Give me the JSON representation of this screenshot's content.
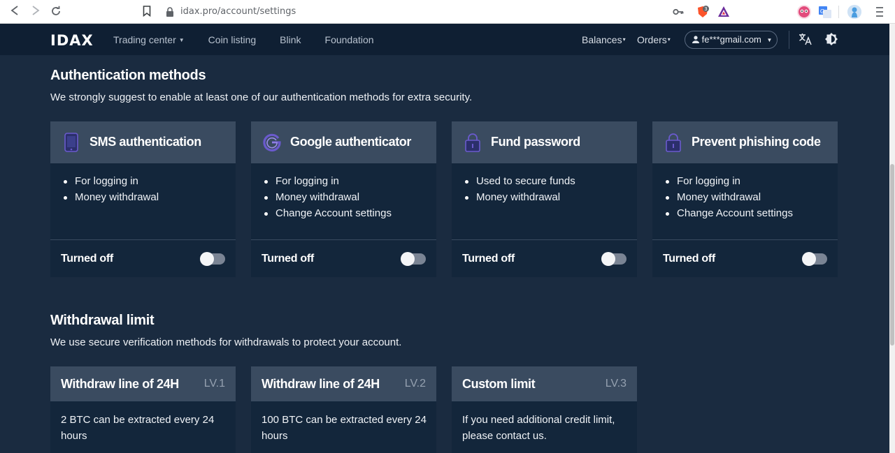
{
  "browser": {
    "url": "idax.pro/account/settings",
    "brave_badge": "3"
  },
  "header": {
    "logo": "IDAX",
    "nav": [
      "Trading center",
      "Coin listing",
      "Blink",
      "Foundation"
    ],
    "balances": "Balances",
    "orders": "Orders",
    "user": "fe***gmail.com"
  },
  "auth": {
    "title": "Authentication methods",
    "description": "We strongly suggest to enable at least one of our authentication methods for extra security.",
    "cards": [
      {
        "title": "SMS authentication",
        "icon": "phone-icon",
        "items": [
          "For logging in",
          "Money withdrawal"
        ],
        "status": "Turned off",
        "enabled": false
      },
      {
        "title": "Google authenticator",
        "icon": "google-icon",
        "items": [
          "For logging in",
          "Money withdrawal",
          "Change Account settings"
        ],
        "status": "Turned off",
        "enabled": false
      },
      {
        "title": "Fund password",
        "icon": "lock-icon",
        "items": [
          "Used to secure funds",
          "Money withdrawal"
        ],
        "status": "Turned off",
        "enabled": false
      },
      {
        "title": "Prevent phishing code",
        "icon": "lock-icon",
        "items": [
          "For logging in",
          "Money withdrawal",
          "Change Account settings"
        ],
        "status": "Turned off",
        "enabled": false
      }
    ]
  },
  "withdrawal": {
    "title": "Withdrawal limit",
    "description": "We use secure verification methods for withdrawals to protect your account.",
    "cards": [
      {
        "title": "Withdraw line of 24H",
        "level": "LV.1",
        "text": "2 BTC can be extracted every 24 hours"
      },
      {
        "title": "Withdraw line of 24H",
        "level": "LV.2",
        "text": "100 BTC can be extracted every 24 hours"
      },
      {
        "title": "Custom limit",
        "level": "LV.3",
        "text": "If you need additional credit limit, please contact us."
      }
    ]
  },
  "colors": {
    "page_bg": "#1a2b40",
    "header_bg": "#0f1f33",
    "card_bg": "#13263b",
    "card_head": "#3a4b60",
    "icon_purple": "#6a5acd"
  }
}
